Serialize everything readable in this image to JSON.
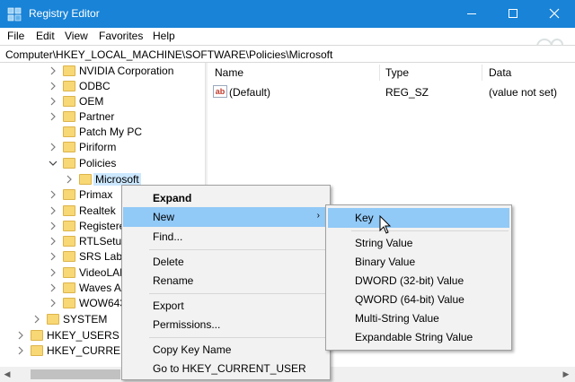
{
  "window": {
    "title": "Registry Editor"
  },
  "menu": [
    "File",
    "Edit",
    "View",
    "Favorites",
    "Help"
  ],
  "address": "Computer\\HKEY_LOCAL_MACHINE\\SOFTWARE\\Policies\\Microsoft",
  "tree": [
    {
      "label": "NVIDIA Corporation",
      "expander": "collapsed"
    },
    {
      "label": "ODBC",
      "expander": "collapsed"
    },
    {
      "label": "OEM",
      "expander": "collapsed"
    },
    {
      "label": "Partner",
      "expander": "collapsed"
    },
    {
      "label": "Patch My PC",
      "expander": "none"
    },
    {
      "label": "Piriform",
      "expander": "collapsed"
    },
    {
      "label": "Policies",
      "expander": "expanded"
    },
    {
      "label": "Microsoft",
      "expander": "collapsed",
      "selected": true
    },
    {
      "label": "Primax",
      "expander": "collapsed"
    },
    {
      "label": "Realtek",
      "expander": "collapsed"
    },
    {
      "label": "Registere",
      "expander": "collapsed"
    },
    {
      "label": "RTLSetup",
      "expander": "collapsed"
    },
    {
      "label": "SRS Labs",
      "expander": "collapsed"
    },
    {
      "label": "VideoLAN",
      "expander": "collapsed"
    },
    {
      "label": "Waves A",
      "expander": "collapsed"
    },
    {
      "label": "WOW643",
      "expander": "collapsed"
    },
    {
      "label": "SYSTEM",
      "expander": "collapsed"
    },
    {
      "label": "HKEY_USERS",
      "expander": "collapsed"
    },
    {
      "label": "HKEY_CURRENT",
      "expander": "collapsed"
    }
  ],
  "list": {
    "columns": [
      "Name",
      "Type",
      "Data"
    ],
    "rows": [
      {
        "name": "(Default)",
        "type": "REG_SZ",
        "data": "(value not set)",
        "icon": "ab-string-icon"
      }
    ]
  },
  "context_menu": {
    "items": [
      "Expand",
      "New",
      "Find...",
      "Delete",
      "Rename",
      "Export",
      "Permissions...",
      "Copy Key Name",
      "Go to HKEY_CURRENT_USER"
    ],
    "submenu_arrow": "›"
  },
  "submenu": {
    "items": [
      "Key",
      "String Value",
      "Binary Value",
      "DWORD (32-bit) Value",
      "QWORD (64-bit) Value",
      "Multi-String Value",
      "Expandable String Value"
    ]
  },
  "colors": {
    "titlebar": "#1883d7",
    "highlight": "#91c9f7",
    "selection": "#cce8ff",
    "folder": "#f8d775"
  }
}
